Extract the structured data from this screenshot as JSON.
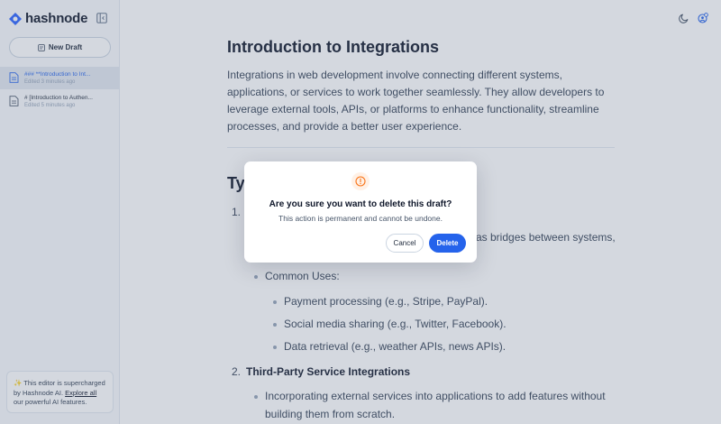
{
  "sidebar": {
    "brand": "hashnode",
    "new_draft_label": "New Draft",
    "drafts": [
      {
        "title": "### **Introduction to Int...",
        "meta": "Edited 3 minutes ago",
        "active": true
      },
      {
        "title": "# [Introduction to Authen...",
        "meta": "Edited 5 minutes ago",
        "active": false
      }
    ],
    "ai_promo": {
      "sparkle": "✨",
      "text_before": " This editor is supercharged by Hashnode AI. ",
      "link": "Explore all",
      "text_after": " our powerful AI features."
    }
  },
  "header": {
    "icons": [
      "collapse-sidebar-icon",
      "moon-icon",
      "profile-settings-icon"
    ]
  },
  "article": {
    "title": "Introduction to Integrations",
    "intro": "Integrations in web development involve connecting different systems, applications, or services to work together seamlessly. They allow developers to leverage external tools, APIs, or platforms to enhance functionality, streamline processes, and provide a better user experience.",
    "section_title_partial": "Ty",
    "list": {
      "item1_number": "1.",
      "item1_partial_text": "as bridges between systems,",
      "common_uses_label": "Common Uses:",
      "uses": [
        "Payment processing (e.g., Stripe, PayPal).",
        "Social media sharing (e.g., Twitter, Facebook).",
        "Data retrieval (e.g., weather APIs, news APIs)."
      ],
      "item2_number": "2.",
      "item2_title": "Third-Party Service Integrations",
      "item2_desc_line1": "Incorporating external services into applications to add features without",
      "item2_desc_line2": "building them from scratch."
    }
  },
  "modal": {
    "title": "Are you sure you want to delete this draft?",
    "description": "This action is permanent and cannot be undone.",
    "cancel_label": "Cancel",
    "delete_label": "Delete"
  },
  "colors": {
    "accent": "#2563eb",
    "warning": "#f97316"
  }
}
